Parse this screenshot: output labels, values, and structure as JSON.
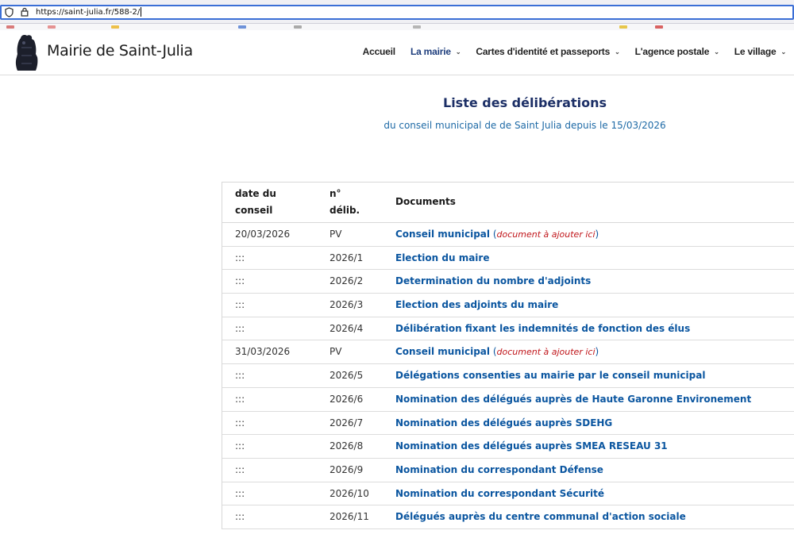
{
  "browser": {
    "url": "https://saint-julia.fr/588-2/",
    "shield_icon": "shield-icon",
    "lock_icon": "lock-icon"
  },
  "header": {
    "site_title": "Mairie de Saint-Julia",
    "nav": [
      {
        "label": "Accueil",
        "has_menu": false,
        "active": false
      },
      {
        "label": "La mairie",
        "has_menu": true,
        "active": true
      },
      {
        "label": "Cartes d'identité et passeports",
        "has_menu": true,
        "active": false
      },
      {
        "label": "L'agence postale",
        "has_menu": true,
        "active": false
      },
      {
        "label": "Le village",
        "has_menu": true,
        "active": false
      }
    ]
  },
  "page": {
    "title": "Liste des délibérations",
    "subtitle": "du conseil municipal de de Saint Julia depuis  le 15/03/2026"
  },
  "table": {
    "headers": {
      "date_line1": "date du",
      "date_line2": "conseil",
      "num_line1": "n°",
      "num_line2": "délib.",
      "documents": "Documents"
    },
    "rows": [
      {
        "date": "20/03/2026",
        "num": "PV",
        "doc": "Conseil municipal",
        "note": "document à ajouter ici"
      },
      {
        "date": ":::",
        "num": "2026/1",
        "doc": "Election du maire",
        "note": ""
      },
      {
        "date": ":::",
        "num": "2026/2",
        "doc": "Determination du nombre d'adjoints",
        "note": ""
      },
      {
        "date": ":::",
        "num": "2026/3",
        "doc": "Election des adjoints du maire",
        "note": ""
      },
      {
        "date": ":::",
        "num": "2026/4",
        "doc": "Délibération fixant les indemnités de fonction des élus",
        "note": ""
      },
      {
        "date": "31/03/2026",
        "num": "PV",
        "doc": "Conseil municipal",
        "note": "document à ajouter ici"
      },
      {
        "date": ":::",
        "num": "2026/5",
        "doc": "Délégations consenties au mairie par le conseil municipal",
        "note": ""
      },
      {
        "date": ":::",
        "num": "2026/6",
        "doc": "Nomination des délégués auprès de Haute Garonne Environement",
        "note": ""
      },
      {
        "date": ":::",
        "num": "2026/7",
        "doc": "Nomination des délégués auprès SDEHG",
        "note": ""
      },
      {
        "date": ":::",
        "num": "2026/8",
        "doc": "Nomination des délégués auprès SMEA RESEAU 31",
        "note": ""
      },
      {
        "date": ":::",
        "num": "2026/9",
        "doc": "Nomination du correspondant Défense",
        "note": ""
      },
      {
        "date": ":::",
        "num": "2026/10",
        "doc": "Nomination du correspondant Sécurité",
        "note": ""
      },
      {
        "date": ":::",
        "num": "2026/11",
        "doc": "Délégués auprès du centre communal d'action sociale",
        "note": ""
      }
    ]
  },
  "colors": {
    "link": "#0b56a0",
    "note": "#c0151a",
    "title": "#1c2f66",
    "subtitle": "#1e6aa6",
    "nav_active": "#1d3d7c"
  }
}
